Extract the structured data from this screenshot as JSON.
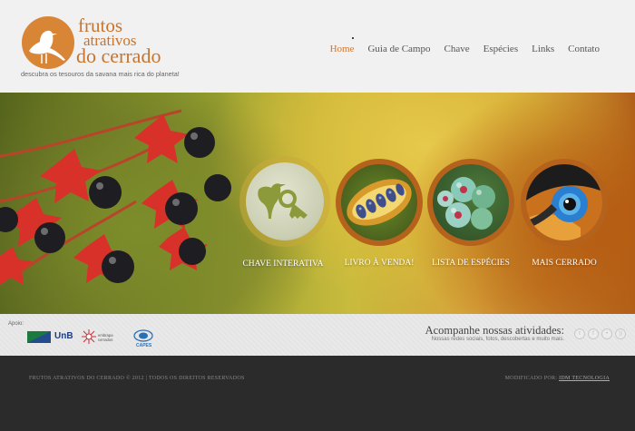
{
  "logo": {
    "line1": "frutos",
    "line2": "atrativos",
    "line3": "do cerrado",
    "tagline": "descubra os tesouros da savana mais rica do planeta!"
  },
  "nav": {
    "items": [
      {
        "label": "Home",
        "active": true
      },
      {
        "label": "Guia de Campo",
        "active": false
      },
      {
        "label": "Chave",
        "active": false
      },
      {
        "label": "Espécies",
        "active": false
      },
      {
        "label": "Links",
        "active": false
      },
      {
        "label": "Contato",
        "active": false
      }
    ]
  },
  "hero": {
    "circles": [
      {
        "label": "CHAVE INTERATIVA",
        "icon": "bird-key-icon"
      },
      {
        "label": "LIVRO À VENDA!",
        "icon": "seed-pod-image"
      },
      {
        "label": "LISTA DE ESPÉCIES",
        "icon": "berries-image"
      },
      {
        "label": "MAIS CERRADO",
        "icon": "toucan-eye-image"
      }
    ]
  },
  "sponsors": {
    "label": "Apoio:",
    "unb": "UnB",
    "embrapa": "Embrapa Cerrados",
    "capes": "CAPES"
  },
  "social": {
    "title": "Acompanhe nossas atividades:",
    "subtitle": "Nossas redes sociais, fotos, descobertas e muito mais.",
    "icons": [
      "twitter-icon",
      "facebook-icon",
      "flickr-icon",
      "rss-icon"
    ]
  },
  "footer": {
    "copyright": "FRUTOS ATRATIVOS DO CERRADO © 2012  |  TODOS OS DIREITOS RESERVADOS",
    "credit_prefix": "MODIFICADO POR:",
    "credit_link": "IDM TECNOLOGIA"
  },
  "colors": {
    "accent": "#d1762e",
    "ring": "#b4621c",
    "footer_bg": "#2b2b2b"
  }
}
